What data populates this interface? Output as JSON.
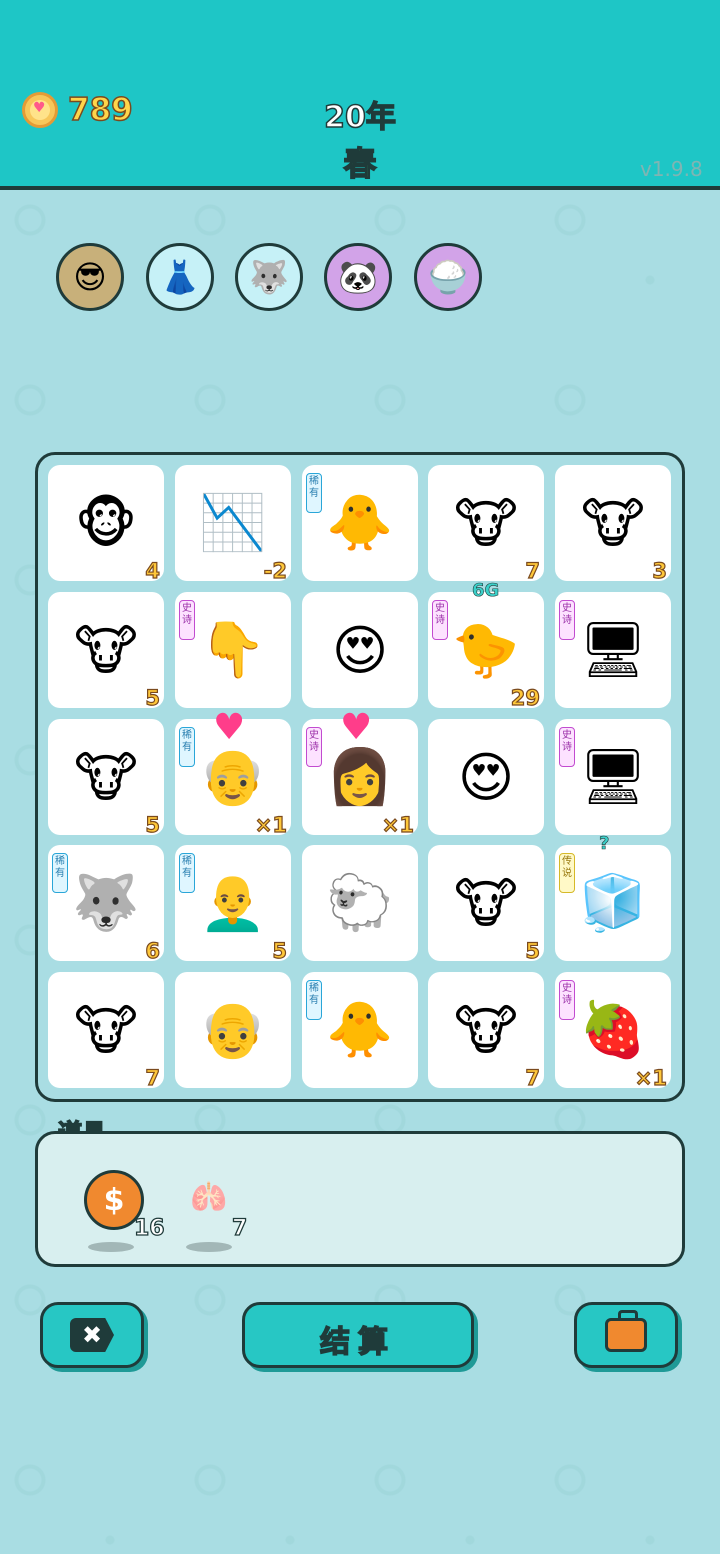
{
  "header": {
    "coins": "789",
    "year": "20年",
    "season": "春",
    "version": "v1.9.8"
  },
  "buffs": [
    {
      "icon": "sunglasses-face",
      "glyph": "😎",
      "bg": "brown"
    },
    {
      "icon": "skirt",
      "glyph": "👗",
      "bg": "light"
    },
    {
      "icon": "husky",
      "glyph": "🐺",
      "bg": "light"
    },
    {
      "icon": "panda",
      "glyph": "🐼",
      "bg": "purple"
    },
    {
      "icon": "rice-bowl",
      "glyph": "🍚",
      "bg": "purple"
    }
  ],
  "grid": [
    {
      "name": "monkey",
      "glyph": "🐵",
      "tag": "",
      "value": "4"
    },
    {
      "name": "stock-down-chart",
      "glyph": "📉",
      "tag": "",
      "value": "-2"
    },
    {
      "name": "chick",
      "glyph": "🐥",
      "tag": "稀有",
      "tagType": "rare",
      "value": ""
    },
    {
      "name": "cow",
      "glyph": "🐮",
      "tag": "",
      "value": "7"
    },
    {
      "name": "cow",
      "glyph": "🐮",
      "tag": "",
      "value": "3"
    },
    {
      "name": "cow",
      "glyph": "🐮",
      "tag": "",
      "value": "5"
    },
    {
      "name": "pointing-hand",
      "glyph": "👇",
      "tag": "史诗",
      "tagType": "epic",
      "value": ""
    },
    {
      "name": "love-face",
      "glyph": "😍",
      "tag": "",
      "value": ""
    },
    {
      "name": "6g-chick",
      "glyph": "🐤",
      "tag": "史诗",
      "tagType": "epic",
      "value": "29",
      "note": "6G"
    },
    {
      "name": "graphics-card",
      "glyph": "🖥",
      "tag": "史诗",
      "tagType": "epic",
      "value": ""
    },
    {
      "name": "cow",
      "glyph": "🐮",
      "tag": "",
      "value": "5"
    },
    {
      "name": "old-man-love",
      "glyph": "👴",
      "tag": "稀有",
      "tagType": "rare",
      "value": "×1",
      "heart": true
    },
    {
      "name": "girl-love",
      "glyph": "👩",
      "tag": "史诗",
      "tagType": "epic",
      "value": "×1",
      "heart": true
    },
    {
      "name": "love-face",
      "glyph": "😍",
      "tag": "",
      "value": ""
    },
    {
      "name": "graphics-card",
      "glyph": "🖥",
      "tag": "史诗",
      "tagType": "epic",
      "value": ""
    },
    {
      "name": "husky",
      "glyph": "🐺",
      "tag": "稀有",
      "tagType": "rare",
      "value": "6"
    },
    {
      "name": "bald-man-love",
      "glyph": "👨‍🦲",
      "tag": "稀有",
      "tagType": "rare",
      "value": "5"
    },
    {
      "name": "sheep",
      "glyph": "🐑",
      "tag": "",
      "value": ""
    },
    {
      "name": "cow",
      "glyph": "🐮",
      "tag": "",
      "value": "5"
    },
    {
      "name": "fridge",
      "glyph": "🧊",
      "tag": "传说",
      "tagType": "legend",
      "value": "",
      "note": "?"
    },
    {
      "name": "cow",
      "glyph": "🐮",
      "tag": "",
      "value": "7"
    },
    {
      "name": "old-man-glasses",
      "glyph": "👴",
      "tag": "",
      "value": ""
    },
    {
      "name": "chick",
      "glyph": "🐥",
      "tag": "稀有",
      "tagType": "rare",
      "value": ""
    },
    {
      "name": "cow",
      "glyph": "🐮",
      "tag": "",
      "value": "7"
    },
    {
      "name": "strawberry",
      "glyph": "🍓",
      "tag": "史诗",
      "tagType": "epic",
      "value": "×1"
    }
  ],
  "items": {
    "title": "道具",
    "list": [
      {
        "icon": "dollar-coin",
        "glyph": "$",
        "count": "16",
        "color": "#f0892f"
      },
      {
        "icon": "liver",
        "glyph": "🫁",
        "count": "7",
        "color": "#f07a7a"
      }
    ]
  },
  "buttons": {
    "settle": "结算",
    "exit_icon": "✖",
    "bag_icon": "briefcase"
  }
}
